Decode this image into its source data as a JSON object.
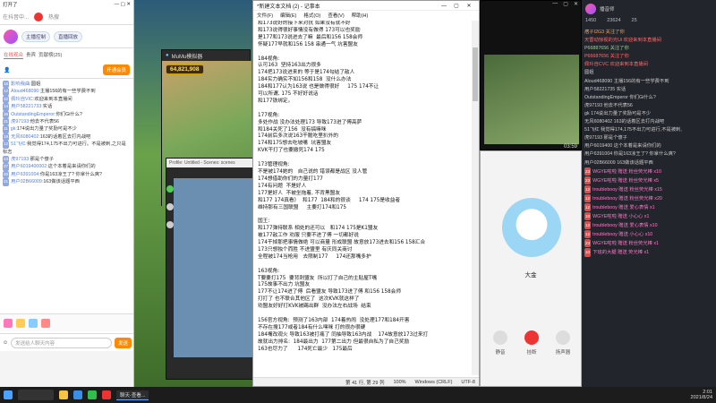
{
  "left_panel": {
    "top_title": "打开了",
    "search_placeholder": "在抖音中...",
    "hot_label": "热搜",
    "host_label": "主播控制",
    "live_label": "直播回放",
    "tabs": [
      "在线观众",
      "贵宾",
      "贡献榜(25)"
    ],
    "audience_btn": "开通会员",
    "chat": [
      {
        "lvl": "16",
        "name": "影响我曲:",
        "text": "圆姐"
      },
      {
        "lvl": "12",
        "name": "Aloud468090:",
        "text": "主播156的有一些学费不到"
      },
      {
        "lvl": "32",
        "name": "佩玲自VIC:",
        "text": "欢迎来到本直播间"
      },
      {
        "lvl": "14",
        "name": "用户58221733:",
        "text": "实话"
      },
      {
        "lvl": "36",
        "name": "OutstandingEmperor:",
        "text": "你们Gi什么?"
      },
      {
        "lvl": "21",
        "name": "虎97193:",
        "text": "他去不代表56"
      },
      {
        "lvl": "11",
        "name": "gk:",
        "text": "174说出力量了奖励可是不少"
      },
      {
        "lvl": "19",
        "name": "无风6080402:",
        "text": "163的话着区去打内战吧"
      },
      {
        "lvl": "12",
        "name": "51飞红:",
        "text": "我觉得174,175不出力可进行。不是被刺,之只是标志"
      },
      {
        "lvl": "23",
        "name": "虎97193:",
        "text": "那是个傻子"
      },
      {
        "lvl": "27",
        "name": "用户6019400002:",
        "text": "这个本着是来请你们的"
      },
      {
        "lvl": "20",
        "name": "用户6391004:",
        "text": "你是163凉王了? 你拿什么爽?"
      },
      {
        "lvl": "21",
        "name": "用户02B66009:",
        "text": "163做该话题平西"
      }
    ],
    "input_placeholder": "发送给人聊天内容",
    "send_label": "发送"
  },
  "mumu": {
    "title": "MuMu模拟器",
    "gold": "64,821,908"
  },
  "recorder": {
    "title": "Profile: Untitled - Scenes: scenes"
  },
  "notepad": {
    "title": "*新建文本文档 (2) - 记事本",
    "menu": [
      "文件(F)",
      "编辑(E)",
      "格式(O)",
      "查看(V)",
      "帮助(H)"
    ],
    "lines": [
      "和173说好的接下来对抗 如果没有就不好",
      "和173说得很好事情没有做得 173可以也奖励",
      "是177和173说进去了嘛  最后和156 158会师",
      "怀疑177早就和156 158 串通一气 坑害盟友",
      "",
      "184视角:",
      "认可163  坚持163出力很多",
      "174把173说进来的 等于是174勾结了敌人",
      "184实力确实不如156和158  没什么办法",
      "184和177认为163说 也是做得很好     175 174不让",
      "可以所谓, 175 不好好说话",
      "和177铁绑定。",
      "",
      "177视角:",
      "多处作战 没办法处理173 导致173进了傅高萨",
      "和184关死了156  没有搞嘛咪",
      "174前后多次说163干脆吃里扒外的",
      "174和175想去吃坡嘴  坑害盟友",
      "KVK干打了也要撤死174 175",
      "",
      "173管理视角:",
      "不是被174她的   自己说的 错误都是战区 没人管",
      "174想借助你们的力量打177",
      "174有问题  不是好人",
      "177是好人  不被坐拖着, 不背黑盟友",
      "和177 174真看)    和177  184和的很谈     174 175是收益者",
      "维持那有三国联盟     主要打174和175",
      "",
      "国王:",
      "和177弹持联系 相处的还可以   和174 175是K1盟友",
      "被177敌工作 劝服 只要不进了傅 一切都好说",
      "174干掉那把事情做绝 可以商量 形成联盟 故意放173进去和156 158汇合",
      "173只想独个而胜 不进盟里 有庆同关商讨",
      "全程被174当枪用   去限制177     174还那嘴多护",
      "",
      "163视角:",
      "T要要打175  要背刺盟友  所以打了自己的主贴屋T嘴",
      "175故事不出力 坑盟友",
      "177不让174进了傅  后看盟友 导致173进了傅 和156 158会师",
      "打打了 也不联合其他区了  这次KVK就这样了",
      "劝盟友好好打KVK被踢出群  没办法左右战场  结束",
      "",
      "156官方视角:  预测了163内部  174着热闹  没处理177和184开害",
      "不存在搜177或者184有什么嘿咪 打的很办很硬",
      "184嘴改观火 导致163被打痛了 同抽导致163内战    174故意放173过来打",
      "故就出力排名:  184最出力  177第二出力 但最很自私为了自己奖励",
      "163也尽力了      174死亡最少   175最后"
    ],
    "status": {
      "pos": "第 41 行, 第 29 列",
      "zoom": "100%",
      "eol": "Windows (CRLF)",
      "enc": "UTF-8"
    }
  },
  "player": {
    "time": "03:59"
  },
  "call": {
    "name": "大金",
    "buttons": [
      "静音",
      "挂断",
      "扬声器"
    ]
  },
  "right_panel": {
    "streamer": "播音师",
    "stats": [
      "1450",
      "23624",
      "25"
    ],
    "messages": [
      {
        "cls": "u-or",
        "badge": "",
        "text": "痞子I2G3 关注了你"
      },
      {
        "cls": "u-red",
        "badge": "",
        "text": "天雷动惊视的光Ui 欢迎来到本直播间"
      },
      {
        "cls": "u-gr",
        "badge": "",
        "text": "P66887656 关注了你"
      },
      {
        "cls": "u-red",
        "badge": "",
        "text": "P66687656 关注了你"
      },
      {
        "cls": "u-red",
        "badge": "",
        "text": "佩玲自CVC 欢迎来到本直播间"
      },
      {
        "cls": "",
        "badge": "",
        "text": "圆姐"
      },
      {
        "cls": "",
        "badge": "",
        "text": "Aloud468090  主播156的有一些学费不到"
      },
      {
        "cls": "",
        "badge": "",
        "text": "用户58221735  实话"
      },
      {
        "cls": "",
        "badge": "",
        "text": "OutstandingEmperor  你们Gi什么?"
      },
      {
        "cls": "",
        "badge": "",
        "text": "虎97193  他去不代表56"
      },
      {
        "cls": "",
        "badge": "",
        "text": "gk  174说出力量了奖励可是不少"
      },
      {
        "cls": "",
        "badge": "",
        "text": "无风6080402  163的话着区去打内战吧"
      },
      {
        "cls": "",
        "badge": "",
        "text": "51飞红  我觉得174,175不出力可进行,不是被刺,"
      },
      {
        "cls": "",
        "badge": "",
        "text": "虎97193  那是个傻子"
      },
      {
        "cls": "",
        "badge": "",
        "text": "用户6019400  这个本着是来请你们的"
      },
      {
        "cls": "",
        "badge": "",
        "text": "用户6391004  你是163凉王了? 你拿什么爽?"
      },
      {
        "cls": "",
        "badge": "",
        "text": "用户02B66009  163做该话题平西"
      },
      {
        "cls": "u-pk",
        "badge": "23",
        "text": "WGYE啦啦 赠送 粉丝荧光棒 x10"
      },
      {
        "cls": "u-pk",
        "badge": "23",
        "text": "WGYE啦啦 赠送 粉丝荧光棒 x5"
      },
      {
        "cls": "u-pk",
        "badge": "12",
        "text": "troublebooy 赠送 粉丝荧光棒 x15"
      },
      {
        "cls": "u-pk",
        "badge": "12",
        "text": "troublebooy 赠送 粉丝荧光棒 x20"
      },
      {
        "cls": "u-pk",
        "badge": "12",
        "text": "troublebooy 赠送 爱心表情 x1"
      },
      {
        "cls": "u-pk",
        "badge": "10",
        "text": "WGYE啦啦 赠送 小心心 x1"
      },
      {
        "cls": "u-pk",
        "badge": "12",
        "text": "troublebooy 赠送 爱心表情 x10"
      },
      {
        "cls": "u-pk",
        "badge": "12",
        "text": "troublebooy 赠送 小心心 x10"
      },
      {
        "cls": "u-pk",
        "badge": "23",
        "text": "WGYE啦啦 赠送 粉丝荧光棒 x1"
      },
      {
        "cls": "u-pk",
        "badge": "10",
        "text": "下班的大腿 赠送 荧光棒 x1"
      }
    ]
  },
  "taskbar": {
    "active_app": "聊天-查看...",
    "time": "2:01",
    "date": "2021/8/24"
  }
}
